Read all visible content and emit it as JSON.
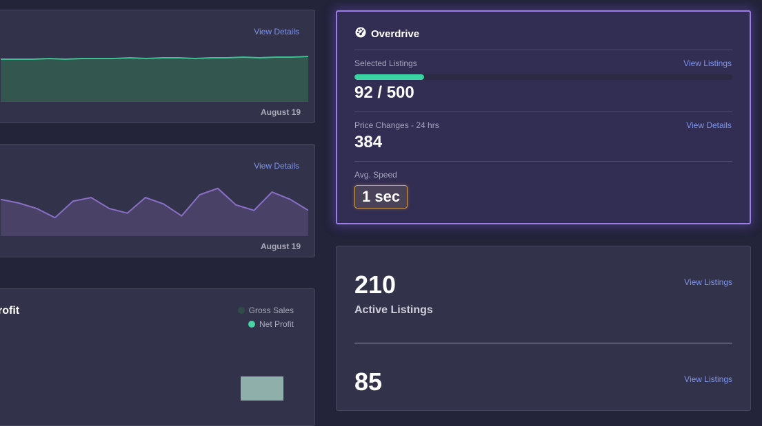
{
  "colors": {
    "accent": "#7f95ec",
    "teal": "#3ad3a2",
    "purple_line": "#8a6fc7",
    "bar": "#8fb0aa"
  },
  "cards": {
    "top_chart": {
      "link": "View Details",
      "date": "August 19"
    },
    "mid_chart": {
      "link": "View Details",
      "date": "August 19"
    }
  },
  "profit": {
    "title_partial": "rofit",
    "legend": [
      {
        "label": "Gross Sales",
        "color": "#2f4d48",
        "icon": "circle-dot"
      },
      {
        "label": "Net Profit",
        "color": "#49d3a5",
        "icon": "circle-dot"
      }
    ]
  },
  "overdrive": {
    "title": "Overdrive",
    "icon": "dashboard-gauge-icon",
    "selected_label": "Selected Listings",
    "selected_link": "View Listings",
    "progress_value": 0.184,
    "selected_value": "92 / 500",
    "price_label": "Price Changes - 24 hrs",
    "price_link": "View Details",
    "price_value": "384",
    "speed_label": "Avg. Speed",
    "speed_value": "1 sec"
  },
  "stats": {
    "items": [
      {
        "value": "210",
        "label": "Active Listings",
        "link": "View Listings"
      },
      {
        "value": "85",
        "label": "",
        "link": "View Listings"
      }
    ]
  },
  "chart_data": [
    {
      "type": "area",
      "series": [
        {
          "values": [
            62,
            62,
            62,
            63,
            62,
            63,
            63,
            63,
            64,
            63,
            64,
            64,
            63,
            64,
            64,
            65,
            64,
            65,
            65,
            66
          ]
        }
      ],
      "xlabel": "August 19"
    },
    {
      "type": "area",
      "series": [
        {
          "values": [
            40,
            36,
            30,
            20,
            38,
            42,
            30,
            25,
            42,
            35,
            22,
            45,
            52,
            34,
            28,
            48,
            40,
            28
          ]
        }
      ],
      "xlabel": "August 19"
    },
    {
      "type": "bar",
      "series": [
        {
          "name": "Net Profit",
          "values": [
            8,
            36
          ]
        }
      ]
    }
  ]
}
